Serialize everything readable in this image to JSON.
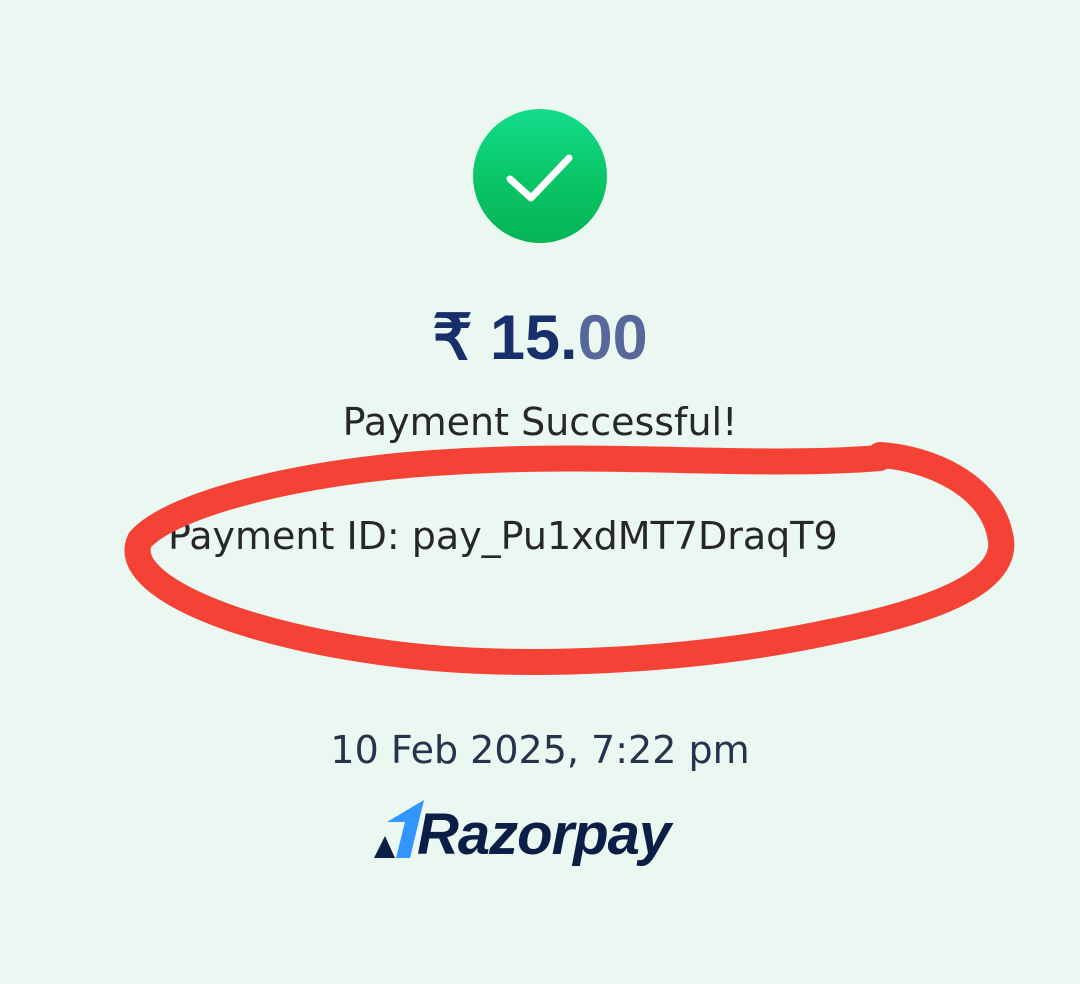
{
  "receipt": {
    "status_icon": "checkmark-icon",
    "amount": {
      "currency_symbol": "₹",
      "whole": "15.",
      "decimals": "00"
    },
    "status_text": "Payment Successful!",
    "payment_id_text": "Payment ID: pay_Pu1xdMT7DraqT9",
    "datetime": "10 Feb 2025, 7:22 pm",
    "brand": {
      "name": "Razorpay",
      "logo_icon": "razorpay-logo-icon"
    }
  },
  "annotation": {
    "type": "hand-drawn-circle",
    "color": "#f44336"
  },
  "colors": {
    "background": "#ebf7f1",
    "success_green": "#09c466",
    "amount_navy": "#17306b",
    "brand_navy": "#0b1e45",
    "brand_blue": "#3395ff"
  }
}
